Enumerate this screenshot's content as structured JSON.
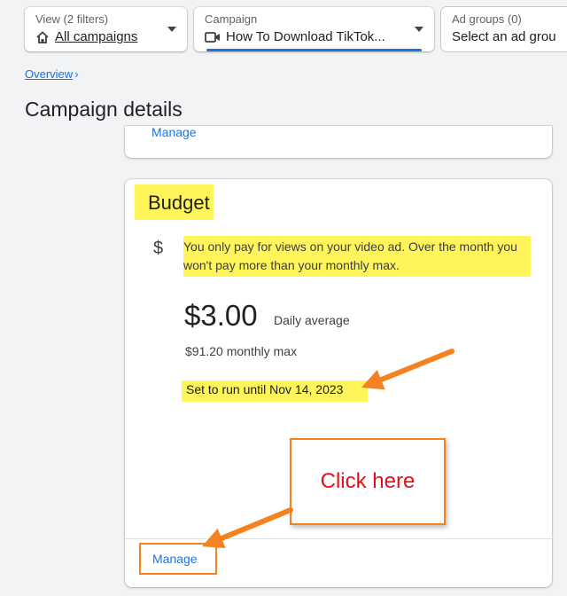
{
  "filters": {
    "view": {
      "label": "View (2 filters)",
      "value": "All campaigns",
      "icon": "home-icon"
    },
    "campaign": {
      "label": "Campaign",
      "value": "How To Download TikTok...",
      "icon": "video-camera-icon"
    },
    "ad_groups": {
      "label": "Ad groups (0)",
      "value": "Select an ad grou"
    }
  },
  "breadcrumb": {
    "overview": "Overview",
    "separator": "›"
  },
  "page_title": "Campaign details",
  "top_card": {
    "manage_label": "Manage"
  },
  "budget": {
    "title": "Budget",
    "icon_symbol": "$",
    "description": "You only pay for views on your video ad. Over the month you won't pay more than your monthly max.",
    "amount": "$3.00",
    "amount_label": "Daily average",
    "monthly_max": "$91.20 monthly max",
    "run_until": "Set to run until Nov 14, 2023",
    "manage_label": "Manage"
  },
  "annotation": {
    "callout_text": "Click here"
  },
  "colors": {
    "accent": "#1a73e8",
    "highlight": "#fff45a",
    "annotation_orange": "#f58220",
    "annotation_red": "#e3101b"
  }
}
